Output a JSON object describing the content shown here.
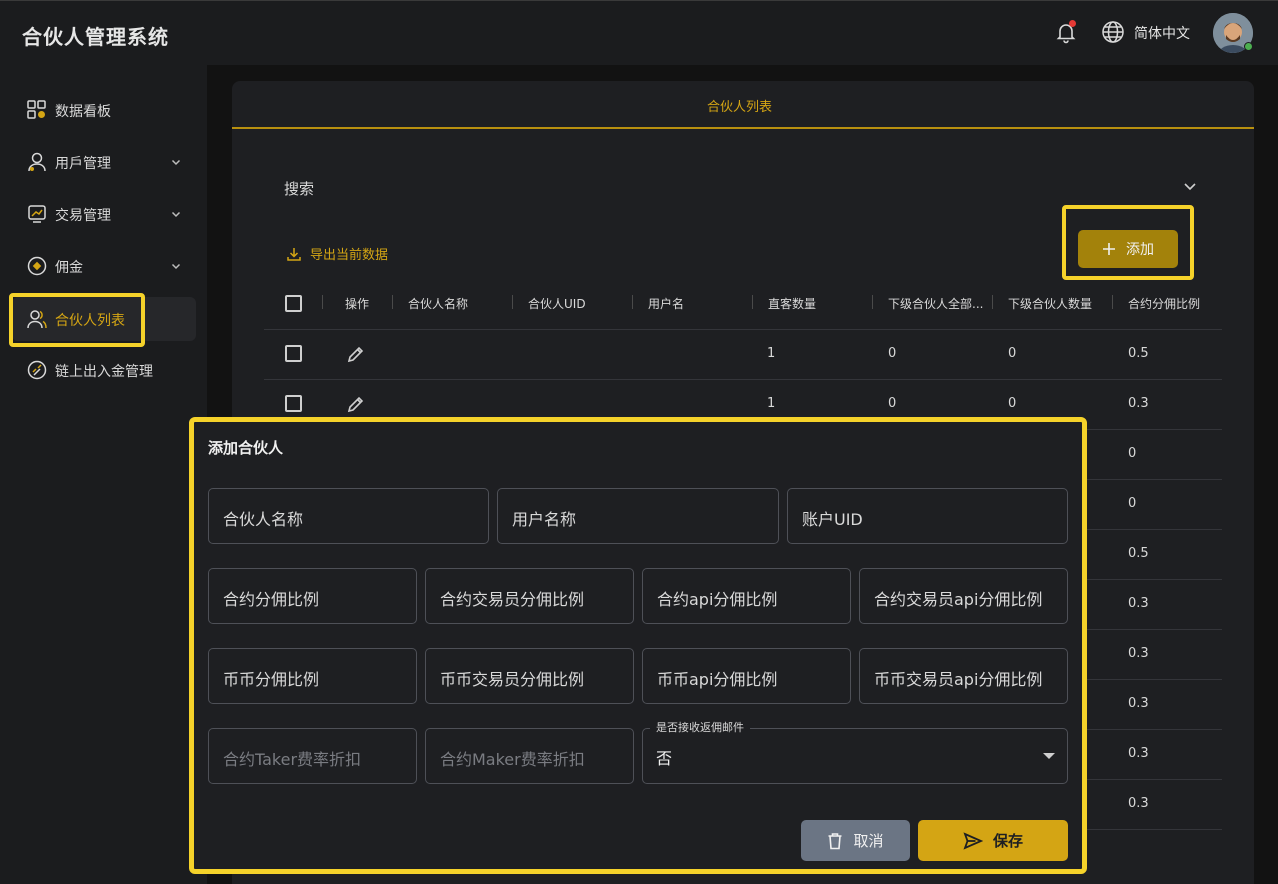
{
  "header": {
    "app_title": "合伙人管理系统",
    "language": "简体中文"
  },
  "sidebar": {
    "items": [
      {
        "label": "数据看板",
        "icon": "dashboard-icon"
      },
      {
        "label": "用戶管理",
        "icon": "user-icon",
        "expandable": true
      },
      {
        "label": "交易管理",
        "icon": "trade-icon",
        "expandable": true
      },
      {
        "label": "佣金",
        "icon": "coin-icon",
        "expandable": true
      },
      {
        "label": "合伙人列表",
        "icon": "partners-icon",
        "active": true
      },
      {
        "label": "链上出入金管理",
        "icon": "chain-icon"
      }
    ]
  },
  "main": {
    "tab_label": "合伙人列表",
    "search_label": "搜索",
    "export_label": "导出当前数据",
    "add_label": "添加",
    "table": {
      "headers": [
        "操作",
        "合伙人名称",
        "合伙人UID",
        "用户名",
        "直客数量",
        "下级合伙人全部...",
        "下级合伙人数量",
        "合约分佣比例"
      ],
      "rows": [
        {
          "direct": "1",
          "all_sub": "0",
          "sub": "0",
          "ratio": "0.5"
        },
        {
          "direct": "1",
          "all_sub": "0",
          "sub": "0",
          "ratio": "0.3"
        },
        {
          "direct": "",
          "all_sub": "",
          "sub": "",
          "ratio": "0"
        },
        {
          "direct": "",
          "all_sub": "",
          "sub": "",
          "ratio": "0"
        },
        {
          "direct": "",
          "all_sub": "",
          "sub": "",
          "ratio": "0.5"
        },
        {
          "direct": "",
          "all_sub": "",
          "sub": "",
          "ratio": "0.3"
        },
        {
          "direct": "",
          "all_sub": "",
          "sub": "",
          "ratio": "0.3"
        },
        {
          "direct": "",
          "all_sub": "",
          "sub": "",
          "ratio": "0.3"
        },
        {
          "direct": "",
          "all_sub": "",
          "sub": "",
          "ratio": "0.3"
        },
        {
          "direct": "",
          "all_sub": "",
          "sub": "",
          "ratio": "0.3"
        }
      ]
    }
  },
  "dialog": {
    "title": "添加合伙人",
    "fields": {
      "partner_name": "合伙人名称",
      "user_name": "用户名称",
      "account_uid": "账户UID",
      "contract_ratio": "合约分佣比例",
      "contract_trader_ratio": "合约交易员分佣比例",
      "contract_api_ratio": "合约api分佣比例",
      "contract_trader_api_ratio": "合约交易员api分佣比例",
      "spot_ratio": "币币分佣比例",
      "spot_trader_ratio": "币币交易员分佣比例",
      "spot_api_ratio": "币币api分佣比例",
      "spot_trader_api_ratio": "币币交易员api分佣比例",
      "taker_discount": "合约Taker费率折扣",
      "maker_discount": "合约Maker费率折扣"
    },
    "email_select": {
      "label": "是否接收返佣邮件",
      "value": "否"
    },
    "cancel_label": "取消",
    "save_label": "保存"
  },
  "colors": {
    "accent": "#d4a514",
    "highlight": "#f5d22a"
  }
}
